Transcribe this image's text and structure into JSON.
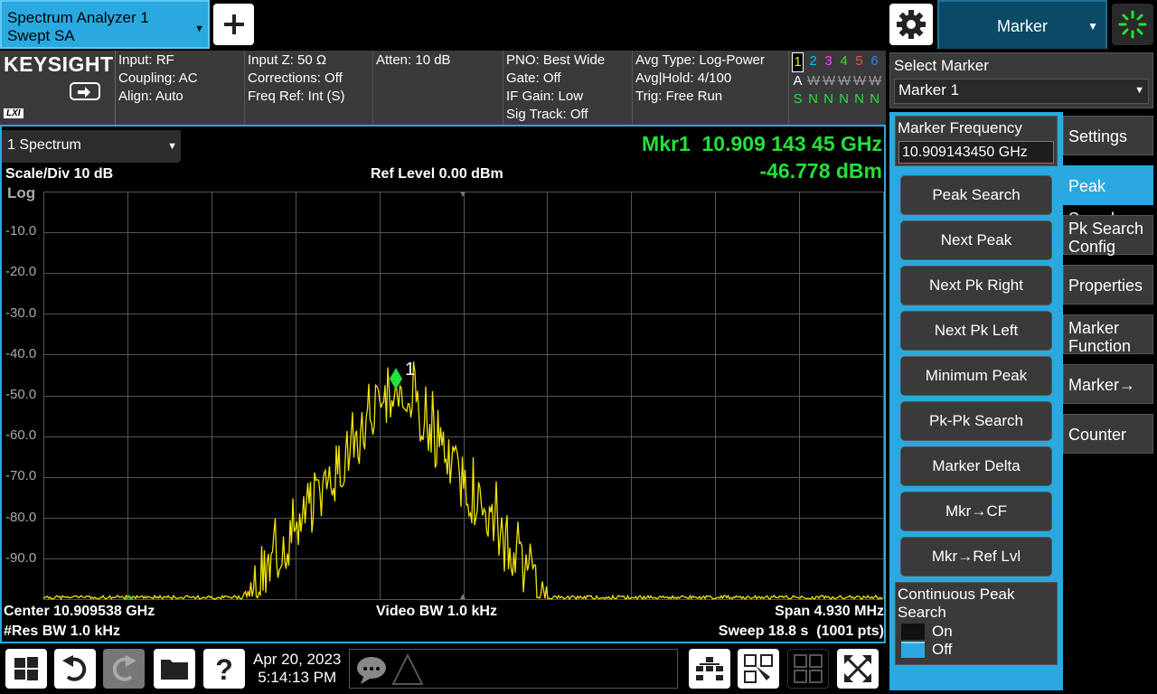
{
  "app_tab": {
    "line1": "Spectrum Analyzer 1",
    "line2": "Swept SA"
  },
  "menu_tab": {
    "label": "Marker"
  },
  "logo": {
    "brand": "KEYSIGHT",
    "lxi": "LXI"
  },
  "info": {
    "col1": [
      "Input: RF",
      "Coupling: AC",
      "Align: Auto"
    ],
    "col2": [
      "Input Z: 50 Ω",
      "Corrections: Off",
      "Freq Ref: Int (S)"
    ],
    "col3": [
      "Atten: 10 dB"
    ],
    "col4": [
      "PNO: Best Wide",
      "Gate: Off",
      "IF Gain: Low",
      "Sig Track: Off"
    ],
    "col5": [
      "Avg Type: Log-Power",
      "Avg|Hold: 4/100",
      "Trig: Free Run"
    ],
    "trace_numbers": [
      "1",
      "2",
      "3",
      "4",
      "5",
      "6"
    ],
    "trace_number_colors": [
      "#f0e400",
      "#00b7ff",
      "#ff3cff",
      "#22e13a",
      "#ff4a4a",
      "#2f7bff"
    ],
    "trace_type": [
      "A",
      "W",
      "W",
      "W",
      "W",
      "W"
    ],
    "trace_detector": [
      "S",
      "N",
      "N",
      "N",
      "N",
      "N"
    ]
  },
  "select_marker": {
    "label": "Select Marker",
    "value": "Marker 1"
  },
  "window": {
    "label": "1 Spectrum"
  },
  "marker": {
    "readout": "Mkr1  10.909 143 45 GHz",
    "value": "-46.778 dBm",
    "label": "1"
  },
  "graph": {
    "scale": "Scale/Div 10 dB",
    "ref_level": "Ref Level 0.00 dBm",
    "log_label": "Log",
    "y_ticks": [
      "-10.0",
      "-20.0",
      "-30.0",
      "-40.0",
      "-50.0",
      "-60.0",
      "-70.0",
      "-80.0",
      "-90.0"
    ],
    "center": "Center 10.909538 GHz",
    "video_bw": "Video BW 1.0 kHz",
    "span": "Span 4.930 MHz",
    "res_bw": "#Res BW 1.0 kHz",
    "sweep": "Sweep 18.8 s",
    "points": "(1001 pts)"
  },
  "marker_menu": {
    "freq_label": "Marker Frequency",
    "freq_value": "10.909143450 GHz",
    "buttons": [
      "Peak Search",
      "Next Peak",
      "Next Pk Right",
      "Next Pk Left",
      "Minimum Peak",
      "Pk-Pk Search",
      "Marker Delta",
      "Mkr→CF",
      "Mkr→Ref Lvl"
    ],
    "continuous_label": "Continuous Peak Search",
    "on": "On",
    "off": "Off"
  },
  "side_tabs": [
    "Settings",
    "Peak Search",
    "Pk Search Config",
    "Properties",
    "Marker Function",
    "Marker→",
    "Counter"
  ],
  "taskbar": {
    "date": "Apr 20, 2023",
    "time": "5:14:13 PM"
  },
  "colors": {
    "accent": "#29a9e0",
    "trace": "#f0e400",
    "marker": "#22e13a"
  }
}
